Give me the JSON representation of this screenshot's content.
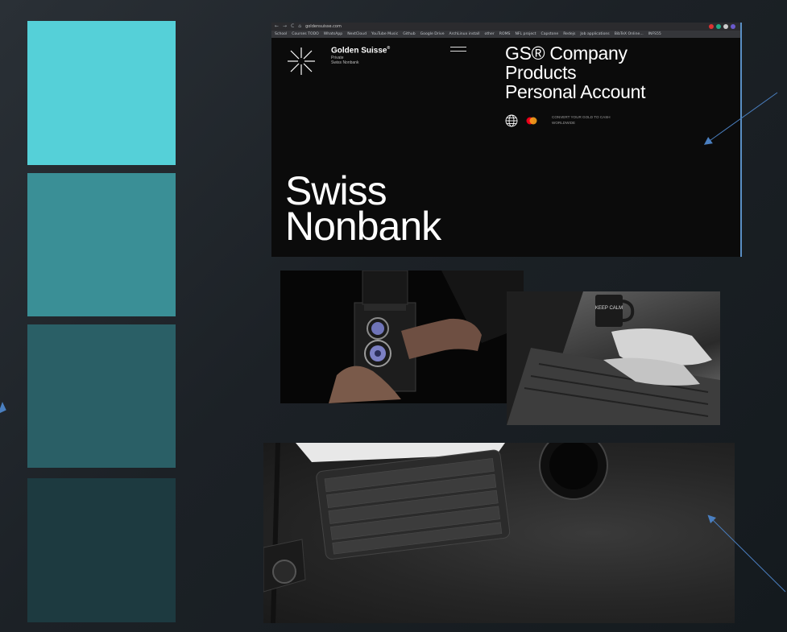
{
  "palette": {
    "swatches": [
      "#55d0d8",
      "#3a8f96",
      "#2a5f66",
      "#1d3a40"
    ]
  },
  "browser": {
    "tabbar": {
      "nav_icons": [
        "←",
        "→",
        "C",
        "⌂"
      ],
      "url": "goldensuisse.com"
    },
    "bookmarks": [
      "School",
      "Courses TODO",
      "WhatsApp",
      "NextCloud",
      "YouTube Music",
      "Github",
      "Google Drive",
      "ArchLinux install",
      "other",
      "ROMS",
      "NFL project",
      "Capstone",
      "Redejs",
      "Job applications",
      "BibTeX Online...",
      "INFS55"
    ],
    "site": {
      "brand": "Golden Suisse",
      "brand_mark": "®",
      "brand_sub1": "Private",
      "brand_sub2": "Swiss Nonbank",
      "menu": [
        "GS® Company",
        "Products",
        "Personal Account"
      ],
      "convert_line1": "CONVERT YOUR GOLD TO CASH",
      "convert_line2": "WORLDWIDE",
      "hero_line1": "Swiss",
      "hero_line2": "Nonbank"
    }
  },
  "photos": {
    "camera": {
      "icon": "camera-photo"
    },
    "laptop": {
      "mug_text": "KEEP CALM"
    },
    "desk": {
      "icon": "keyboard-tablet-photo"
    }
  },
  "colors": {
    "arrow": "#4a7fc0"
  }
}
